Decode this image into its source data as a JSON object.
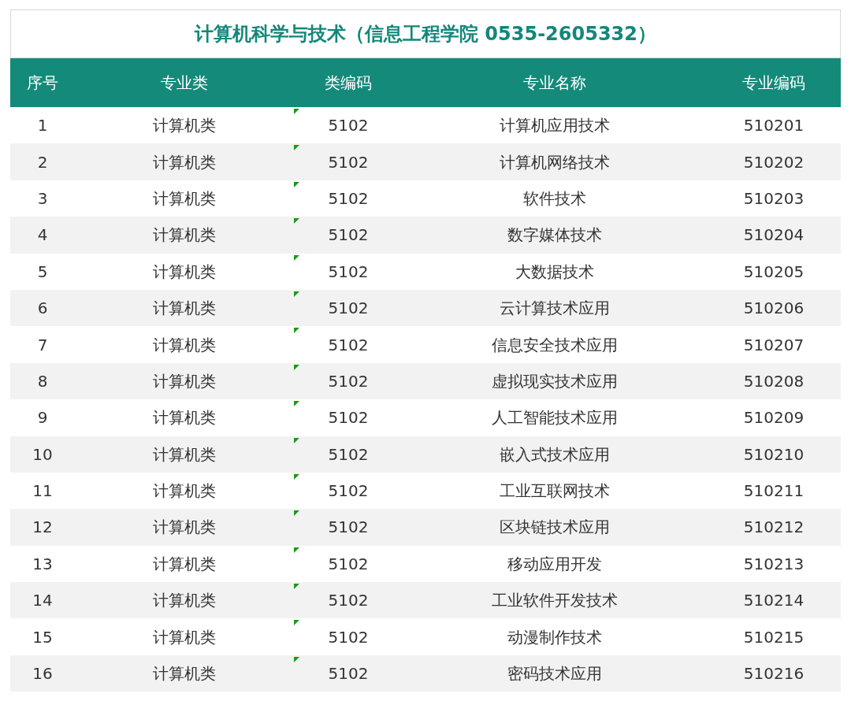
{
  "title": "计算机科学与技术（信息工程学院 0535-2605332）",
  "table": {
    "columns": [
      "序号",
      "专业类",
      "类编码",
      "专业名称",
      "专业编码"
    ],
    "rows": [
      [
        "1",
        "计算机类",
        "5102",
        "计算机应用技术",
        "510201"
      ],
      [
        "2",
        "计算机类",
        "5102",
        "计算机网络技术",
        "510202"
      ],
      [
        "3",
        "计算机类",
        "5102",
        "软件技术",
        "510203"
      ],
      [
        "4",
        "计算机类",
        "5102",
        "数字媒体技术",
        "510204"
      ],
      [
        "5",
        "计算机类",
        "5102",
        "大数据技术",
        "510205"
      ],
      [
        "6",
        "计算机类",
        "5102",
        "云计算技术应用",
        "510206"
      ],
      [
        "7",
        "计算机类",
        "5102",
        "信息安全技术应用",
        "510207"
      ],
      [
        "8",
        "计算机类",
        "5102",
        "虚拟现实技术应用",
        "510208"
      ],
      [
        "9",
        "计算机类",
        "5102",
        "人工智能技术应用",
        "510209"
      ],
      [
        "10",
        "计算机类",
        "5102",
        "嵌入式技术应用",
        "510210"
      ],
      [
        "11",
        "计算机类",
        "5102",
        "工业互联网技术",
        "510211"
      ],
      [
        "12",
        "计算机类",
        "5102",
        "区块链技术应用",
        "510212"
      ],
      [
        "13",
        "计算机类",
        "5102",
        "移动应用开发",
        "510213"
      ],
      [
        "14",
        "计算机类",
        "5102",
        "工业软件开发技术",
        "510214"
      ],
      [
        "15",
        "计算机类",
        "5102",
        "动漫制作技术",
        "510215"
      ],
      [
        "16",
        "计算机类",
        "5102",
        "密码技术应用",
        "510216"
      ]
    ]
  }
}
